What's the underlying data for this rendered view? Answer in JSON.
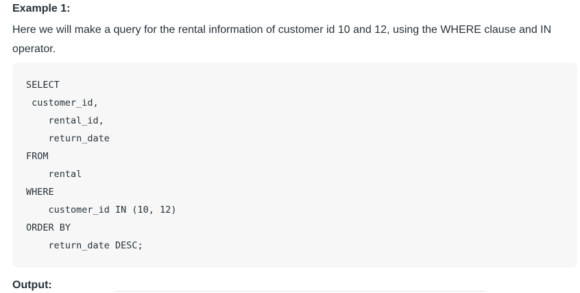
{
  "example": {
    "heading": "Example 1:",
    "description": "Here we will make a query for the rental information of customer id 10 and 12, using the WHERE clause and IN operator."
  },
  "code": {
    "lines": [
      "SELECT",
      " customer_id,",
      "    rental_id,",
      "    return_date",
      "FROM",
      "    rental",
      "WHERE",
      "    customer_id IN (10, 12)",
      "ORDER BY",
      "    return_date DESC;"
    ]
  },
  "output": {
    "heading": "Output:"
  }
}
